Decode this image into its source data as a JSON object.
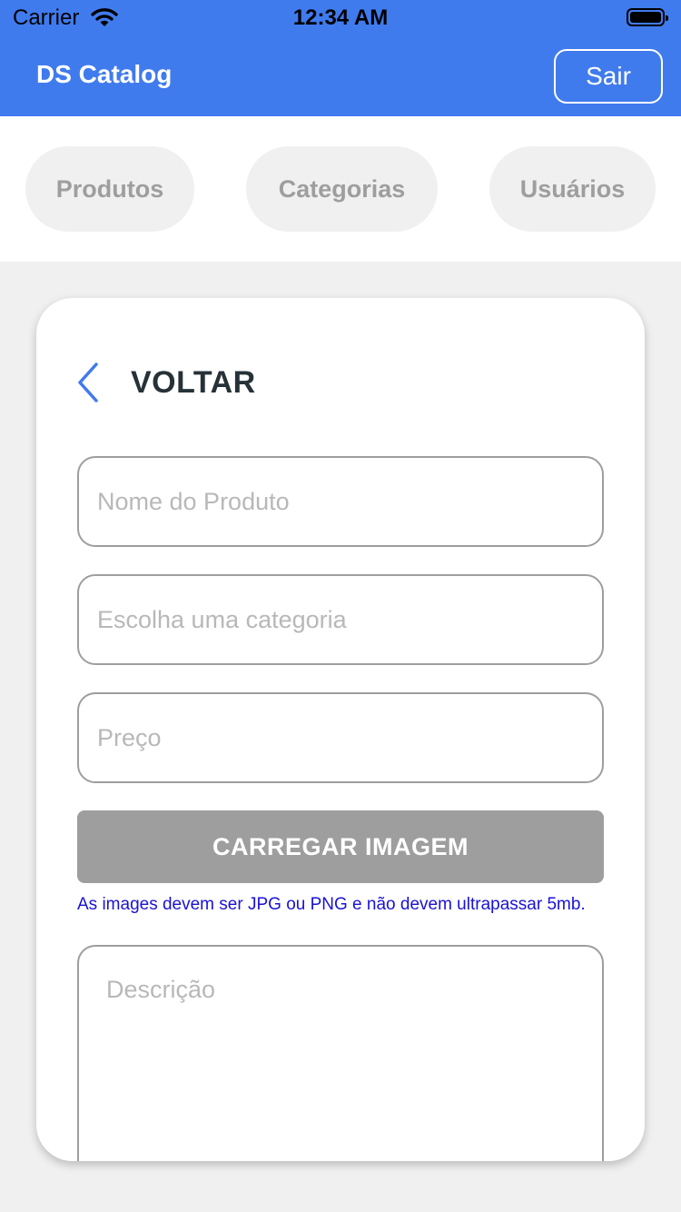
{
  "status_bar": {
    "carrier": "Carrier",
    "time": "12:34 AM"
  },
  "header": {
    "title": "DS Catalog",
    "logout_label": "Sair"
  },
  "nav": {
    "tabs": [
      "Produtos",
      "Categorias",
      "Usuários"
    ]
  },
  "form": {
    "back_label": "VOLTAR",
    "name_placeholder": "Nome do Produto",
    "category_placeholder": "Escolha uma categoria",
    "price_placeholder": "Preço",
    "upload_label": "CARREGAR IMAGEM",
    "upload_hint": "As images devem ser JPG ou PNG e não devem ultrapassar 5mb.",
    "description_placeholder": "Descrição"
  },
  "colors": {
    "primary": "#407bee",
    "tab_bg": "#f0f0f0",
    "muted": "#9e9e9e",
    "hint": "#1a12d6"
  }
}
